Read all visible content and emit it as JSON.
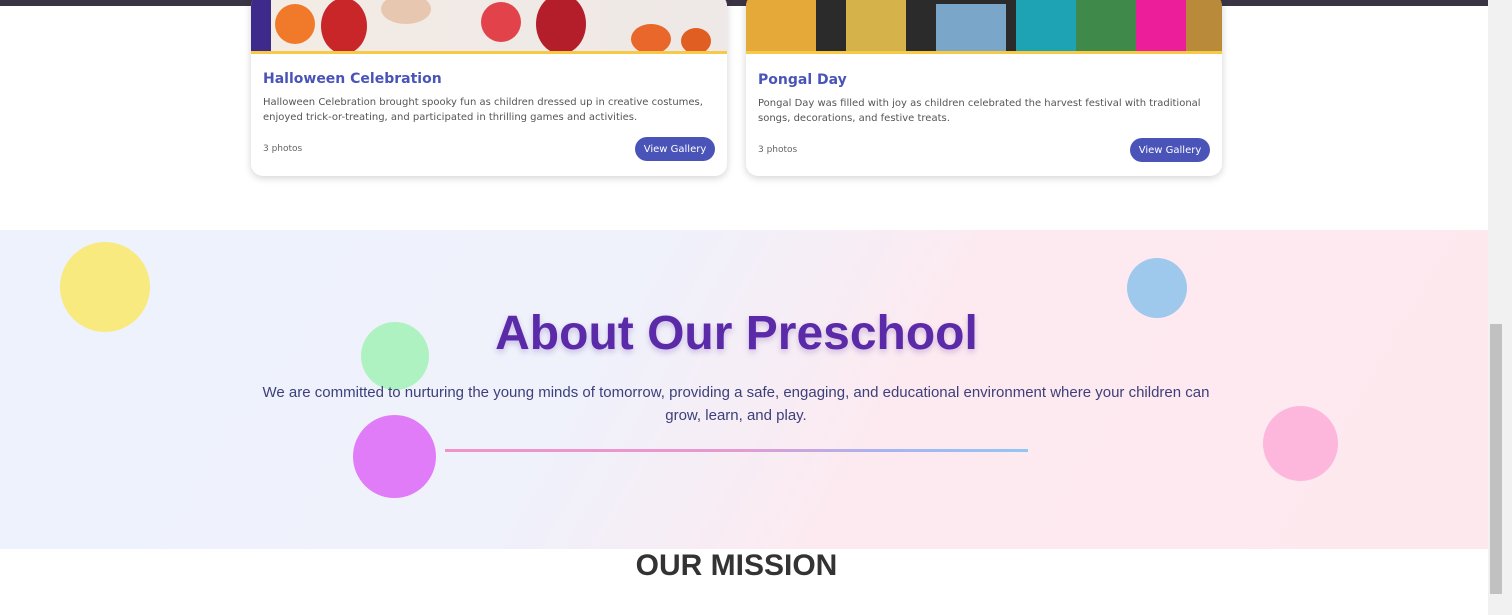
{
  "gallery": {
    "cards": [
      {
        "title": "Halloween Celebration",
        "description": "Halloween Celebration brought spooky fun as children dressed up in creative costumes, enjoyed trick-or-treating, and participated in thrilling games and activities.",
        "count": "3 photos",
        "button": "View Gallery"
      },
      {
        "title": "Pongal Day",
        "description": "Pongal Day was filled with joy as children celebrated the harvest festival with traditional songs, decorations, and festive treats.",
        "count": "3 photos",
        "button": "View Gallery"
      }
    ]
  },
  "about": {
    "title": "About Our Preschool",
    "text": "We are committed to nurturing the young minds of tomorrow, providing a safe, engaging, and educational environment where your children can grow, learn, and play."
  },
  "mission": {
    "title": "OUR MISSION"
  },
  "colors": {
    "accent": "#4a54b8",
    "about_title": "#5a2aa8",
    "card_border": "#f7c948"
  }
}
